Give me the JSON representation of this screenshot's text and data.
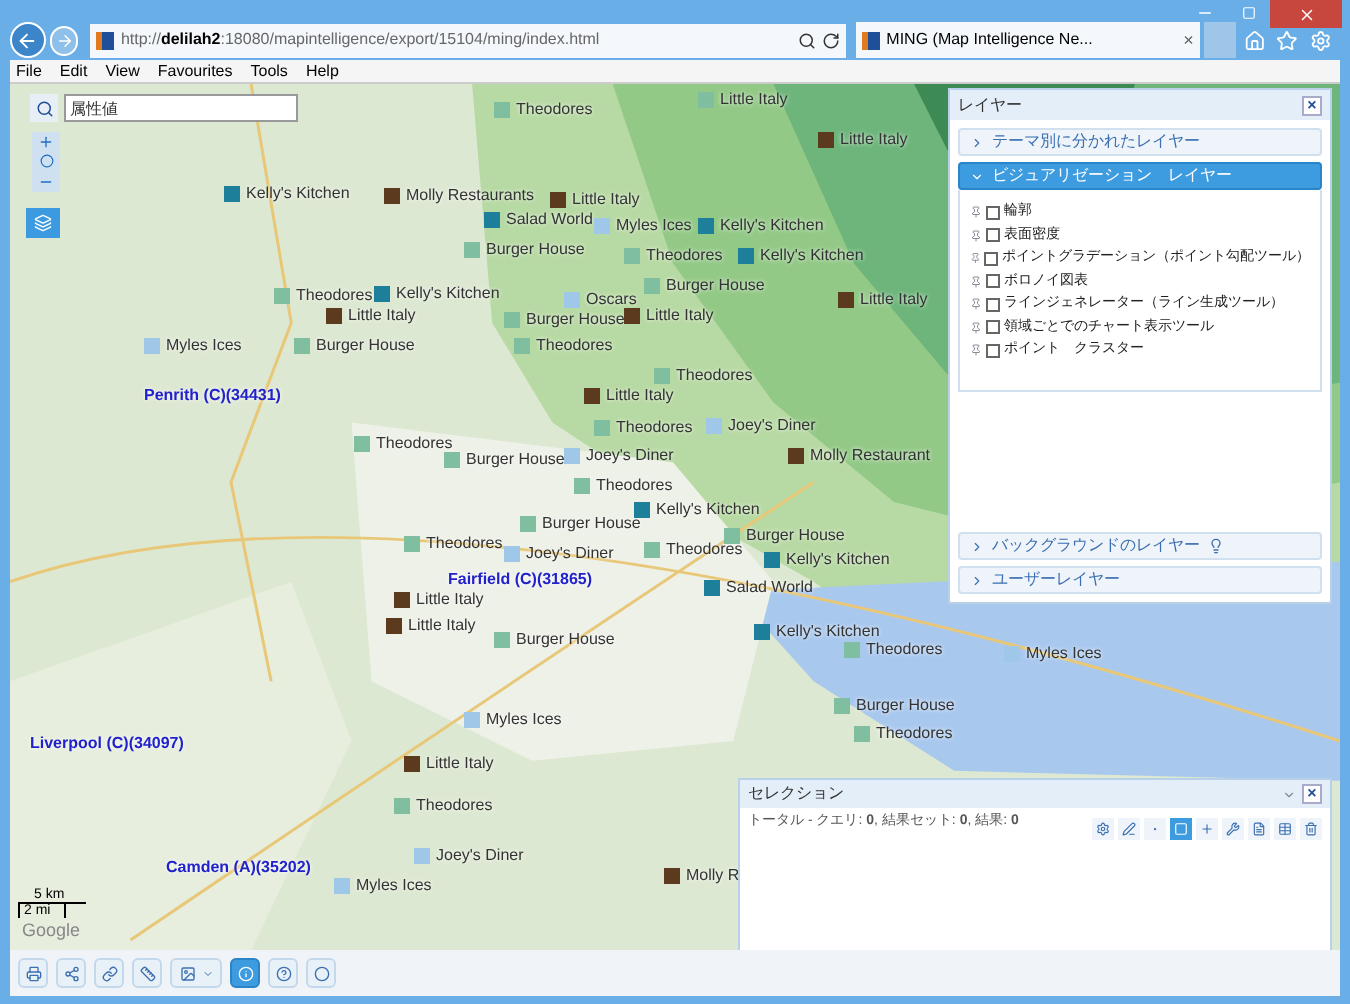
{
  "browser": {
    "address": "http://**delilah2**:18080/mapintelligence/export/15104/ming/index.html",
    "tab": {
      "title": "MING (Map Intelligence Ne...",
      "selected": true
    },
    "close_tab": "×"
  },
  "menu": [
    "File",
    "Edit",
    "View",
    "Favourites",
    "Tools",
    "Help"
  ],
  "map": {
    "search": {
      "placeholder": "属性値"
    },
    "places": [
      "Penrith (C)(34431)",
      "Fairfield (C)(31865)",
      "Liverpool (C)(34097)",
      "Camden (A)(35202)"
    ],
    "pins": [
      {
        "label": "Theodores",
        "color": "#7fbf9f"
      },
      {
        "label": "Little Italy",
        "color": "#7fbf9f"
      },
      {
        "label": "Little Italy",
        "color": "#5b3a1e"
      },
      {
        "label": "Salad World",
        "color": "#1e7f9a"
      },
      {
        "label": "Myles Ices",
        "color": "#9fc7e8"
      },
      {
        "label": "Kelly's Kitchen",
        "color": "#1e7f9a"
      },
      {
        "label": "Kelly's Kitchen",
        "color": "#1e7f9a"
      },
      {
        "label": "Molly Restaurants",
        "color": "#5b3a1e"
      },
      {
        "label": "Little Italy",
        "color": "#5b3a1e"
      },
      {
        "label": "Burger House",
        "color": "#7fbf9f"
      },
      {
        "label": "Theodores",
        "color": "#7fbf9f"
      },
      {
        "label": "Kelly's Kitchen",
        "color": "#1e7f9a"
      },
      {
        "label": "Theodores",
        "color": "#7fbf9f"
      },
      {
        "label": "Kelly's Kitchen",
        "color": "#1e7f9a"
      },
      {
        "label": "Little Italy",
        "color": "#5b3a1e"
      },
      {
        "label": "Oscars",
        "color": "#9fc7e8"
      },
      {
        "label": "Burger House",
        "color": "#7fbf9f"
      },
      {
        "label": "Myles Ices",
        "color": "#9fc7e8"
      },
      {
        "label": "Burger House",
        "color": "#7fbf9f"
      },
      {
        "label": "Burger House",
        "color": "#7fbf9f"
      },
      {
        "label": "Theodores",
        "color": "#7fbf9f"
      },
      {
        "label": "Little Italy",
        "color": "#5b3a1e"
      },
      {
        "label": "Theodores",
        "color": "#7fbf9f"
      },
      {
        "label": "Little Italy",
        "color": "#5b3a1e"
      },
      {
        "label": "Theodores",
        "color": "#7fbf9f"
      },
      {
        "label": "Theodores",
        "color": "#7fbf9f"
      },
      {
        "label": "Joey's Diner",
        "color": "#9fc7e8"
      },
      {
        "label": "Burger House",
        "color": "#7fbf9f"
      },
      {
        "label": "Joey's Diner",
        "color": "#9fc7e8"
      },
      {
        "label": "Theodores",
        "color": "#7fbf9f"
      },
      {
        "label": "Burger House",
        "color": "#7fbf9f"
      },
      {
        "label": "Theodores",
        "color": "#7fbf9f"
      },
      {
        "label": "Joey's Diner",
        "color": "#9fc7e8"
      },
      {
        "label": "Kelly's Kitchen",
        "color": "#1e7f9a"
      },
      {
        "label": "Theodores",
        "color": "#7fbf9f"
      },
      {
        "label": "Burger House",
        "color": "#7fbf9f"
      },
      {
        "label": "Little Italy",
        "color": "#5b3a1e"
      },
      {
        "label": "Salad World",
        "color": "#1e7f9a"
      },
      {
        "label": "Kelly's Kitchen",
        "color": "#1e7f9a"
      },
      {
        "label": "Little Italy",
        "color": "#5b3a1e"
      },
      {
        "label": "Burger House",
        "color": "#7fbf9f"
      },
      {
        "label": "Kelly's Kitchen",
        "color": "#1e7f9a"
      },
      {
        "label": "Theodores",
        "color": "#7fbf9f"
      },
      {
        "label": "Myles Ices",
        "color": "#9fc7e8"
      },
      {
        "label": "Myles Ices",
        "color": "#9fc7e8"
      },
      {
        "label": "Little Italy",
        "color": "#5b3a1e"
      },
      {
        "label": "Theodores",
        "color": "#7fbf9f"
      },
      {
        "label": "Joey's Diner",
        "color": "#9fc7e8"
      },
      {
        "label": "Myles Ices",
        "color": "#9fc7e8"
      },
      {
        "label": "Burger House",
        "color": "#7fbf9f"
      },
      {
        "label": "Theodores",
        "color": "#7fbf9f"
      },
      {
        "label": "Molly R",
        "color": "#5b3a1e"
      },
      {
        "label": "Little Italy",
        "color": "#5b3a1e"
      },
      {
        "label": "Molly Restaurant",
        "color": "#5b3a1e"
      }
    ],
    "scale": {
      "km": "5 km",
      "mi": "2 mi"
    },
    "attribution": "Google"
  },
  "layers_panel": {
    "title": "レイヤー",
    "close": "×",
    "sections": [
      {
        "title": "テーマ別に分かれたレイヤー",
        "expanded": false
      },
      {
        "title": "ビジュアリゼーション　レイヤー",
        "expanded": true,
        "items": [
          {
            "label": "輪郭",
            "checked": false
          },
          {
            "label": "表面密度",
            "checked": false
          },
          {
            "label": "ポイントグラデーション（ポイント勾配ツール）",
            "checked": false
          },
          {
            "label": "ボロノイ図表",
            "checked": false
          },
          {
            "label": "ラインジェネレーター（ライン生成ツール）",
            "checked": false
          },
          {
            "label": "領域ごとでのチャート表示ツール",
            "checked": false
          },
          {
            "label": "ポイント　クラスター",
            "checked": false
          }
        ]
      },
      {
        "title": "バックグラウンドのレイヤー",
        "expanded": false,
        "hint_icon": true
      },
      {
        "title": "ユーザーレイヤー",
        "expanded": false
      }
    ]
  },
  "selection_panel": {
    "title": "セレクション",
    "close": "×",
    "summary": "トータル - クエリ: **0**, 結果セット: **0**, 結果: **0**",
    "tools": [
      {
        "selected": false
      },
      {
        "selected": false
      },
      {
        "selected": false
      },
      {
        "selected": true
      },
      {
        "selected": false
      },
      {
        "selected": false
      },
      {
        "selected": false
      },
      {
        "selected": false
      },
      {
        "selected": false
      }
    ]
  },
  "toolbar": [
    {
      "selected": false
    },
    {
      "selected": false
    },
    {
      "selected": false
    },
    {
      "selected": false
    },
    {
      "selected": false,
      "dropdown": true
    },
    {
      "selected": true
    },
    {
      "selected": false
    },
    {
      "selected": false
    }
  ]
}
